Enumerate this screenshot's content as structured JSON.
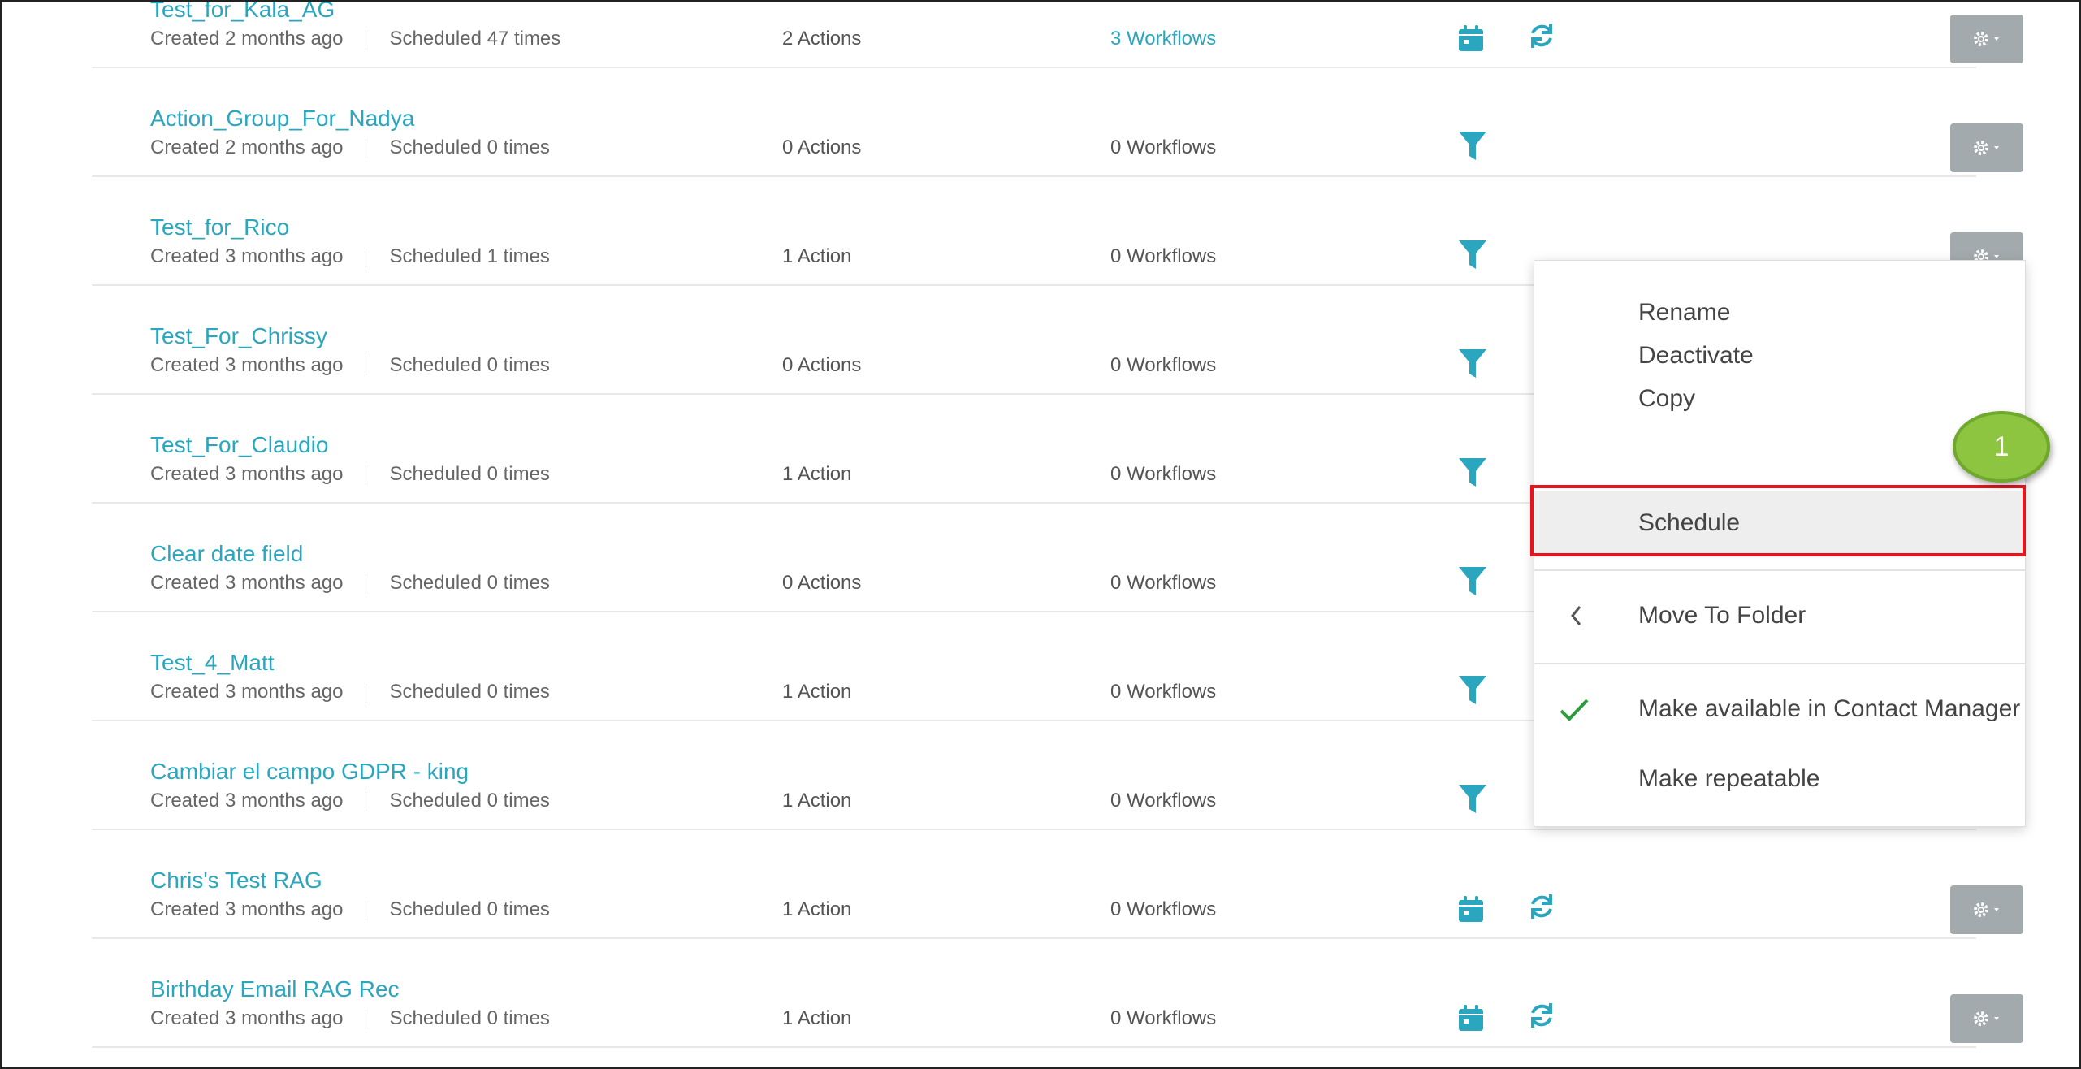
{
  "rows": [
    {
      "name": "Test_for_Kala_AG",
      "created": "Created 2 months ago",
      "scheduled": "Scheduled 47 times",
      "actions": "2 Actions",
      "workflows": "3 Workflows",
      "workflows_link": true,
      "icons": [
        "calendar-icon",
        "refresh-icon"
      ]
    },
    {
      "name": "Action_Group_For_Nadya",
      "created": "Created 2 months ago",
      "scheduled": "Scheduled 0 times",
      "actions": "0 Actions",
      "workflows": "0 Workflows",
      "workflows_link": false,
      "icons": [
        "filter-icon"
      ]
    },
    {
      "name": "Test_for_Rico",
      "created": "Created 3 months ago",
      "scheduled": "Scheduled 1 times",
      "actions": "1 Action",
      "workflows": "0 Workflows",
      "workflows_link": false,
      "icons": [
        "filter-icon"
      ]
    },
    {
      "name": "Test_For_Chrissy",
      "created": "Created 3 months ago",
      "scheduled": "Scheduled 0 times",
      "actions": "0 Actions",
      "workflows": "0 Workflows",
      "workflows_link": false,
      "icons": [
        "filter-icon"
      ]
    },
    {
      "name": "Test_For_Claudio",
      "created": "Created 3 months ago",
      "scheduled": "Scheduled 0 times",
      "actions": "1 Action",
      "workflows": "0 Workflows",
      "workflows_link": false,
      "icons": [
        "filter-icon"
      ]
    },
    {
      "name": "Clear date field",
      "created": "Created 3 months ago",
      "scheduled": "Scheduled 0 times",
      "actions": "0 Actions",
      "workflows": "0 Workflows",
      "workflows_link": false,
      "icons": [
        "filter-icon"
      ]
    },
    {
      "name": "Test_4_Matt",
      "created": "Created 3 months ago",
      "scheduled": "Scheduled 0 times",
      "actions": "1 Action",
      "workflows": "0 Workflows",
      "workflows_link": false,
      "icons": [
        "filter-icon"
      ]
    },
    {
      "name": "Cambiar el campo GDPR - king",
      "created": "Created 3 months ago",
      "scheduled": "Scheduled 0 times",
      "actions": "1 Action",
      "workflows": "0 Workflows",
      "workflows_link": false,
      "icons": [
        "filter-icon"
      ]
    },
    {
      "name": "Chris's Test RAG",
      "created": "Created 3 months ago",
      "scheduled": "Scheduled 0 times",
      "actions": "1 Action",
      "workflows": "0 Workflows",
      "workflows_link": false,
      "icons": [
        "calendar-icon",
        "refresh-icon"
      ]
    },
    {
      "name": "Birthday Email RAG Rec",
      "created": "Created 3 months ago",
      "scheduled": "Scheduled 0 times",
      "actions": "1 Action",
      "workflows": "0 Workflows",
      "workflows_link": false,
      "icons": [
        "calendar-icon",
        "refresh-icon"
      ]
    }
  ],
  "menu": {
    "rename": "Rename",
    "deactivate": "Deactivate",
    "copy": "Copy",
    "schedule": "Schedule",
    "move_to_folder": "Move To Folder",
    "make_available": "Make available in Contact Manager",
    "make_available_checked": true,
    "make_repeatable": "Make repeatable"
  },
  "step_badge": "1",
  "colors": {
    "accent": "#2aa7bf",
    "gear_button": "#a3aaad",
    "highlight": "#e8141c",
    "badge": "#8dc540",
    "check": "#2a9d3a"
  }
}
